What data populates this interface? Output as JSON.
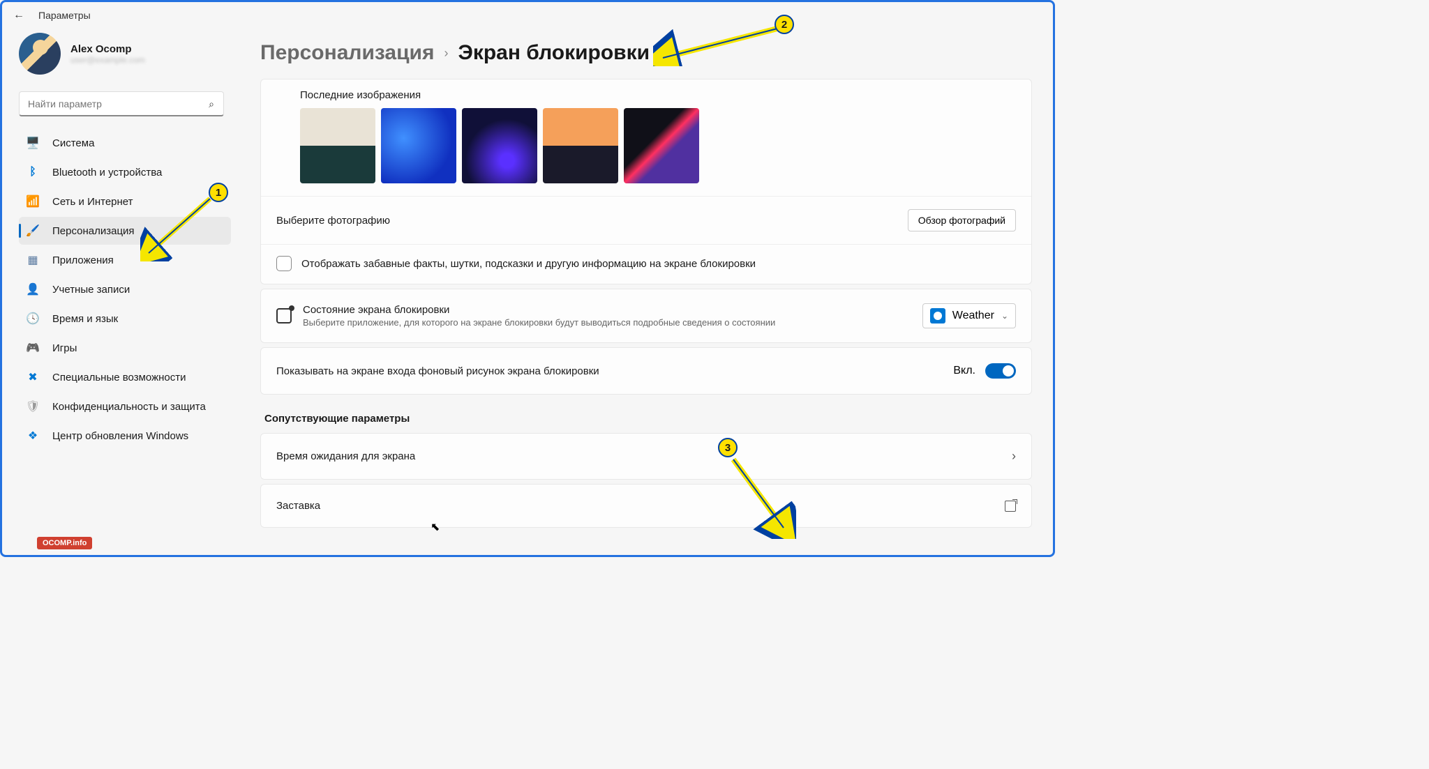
{
  "titlebar": {
    "title": "Параметры"
  },
  "profile": {
    "name": "Alex Ocomp",
    "email": "user@example.com"
  },
  "search": {
    "placeholder": "Найти параметр"
  },
  "nav": {
    "items": [
      {
        "label": "Система",
        "icon": "🖥️"
      },
      {
        "label": "Bluetooth и устройства",
        "icon": "ᛒ"
      },
      {
        "label": "Сеть и Интернет",
        "icon": "📶"
      },
      {
        "label": "Персонализация",
        "icon": "🖌️",
        "active": true
      },
      {
        "label": "Приложения",
        "icon": "▦"
      },
      {
        "label": "Учетные записи",
        "icon": "👤"
      },
      {
        "label": "Время и язык",
        "icon": "🕓"
      },
      {
        "label": "Игры",
        "icon": "🎮"
      },
      {
        "label": "Специальные возможности",
        "icon": "✖"
      },
      {
        "label": "Конфиденциальность и защита",
        "icon": "🛡"
      },
      {
        "label": "Центр обновления Windows",
        "icon": "❖"
      }
    ]
  },
  "breadcrumb": {
    "parent": "Персонализация",
    "current": "Экран блокировки"
  },
  "recent": {
    "label": "Последние изображения"
  },
  "choose_photo": {
    "label": "Выберите фотографию",
    "button": "Обзор фотографий"
  },
  "checkbox_row": {
    "label": "Отображать забавные факты, шутки, подсказки и другую информацию на экране блокировки"
  },
  "status_row": {
    "title": "Состояние экрана блокировки",
    "subtitle": "Выберите приложение, для которого на экране блокировки будут выводиться подробные сведения о состоянии",
    "selected": "Weather"
  },
  "toggle_row": {
    "label": "Показывать на экране входа фоновый рисунок экрана блокировки",
    "state": "Вкл."
  },
  "related": {
    "heading": "Сопутствующие параметры",
    "timeout": "Время ожидания для экрана",
    "screensaver": "Заставка"
  },
  "annotations": {
    "1": "1",
    "2": "2",
    "3": "3"
  },
  "watermark": "OCOMP.info"
}
